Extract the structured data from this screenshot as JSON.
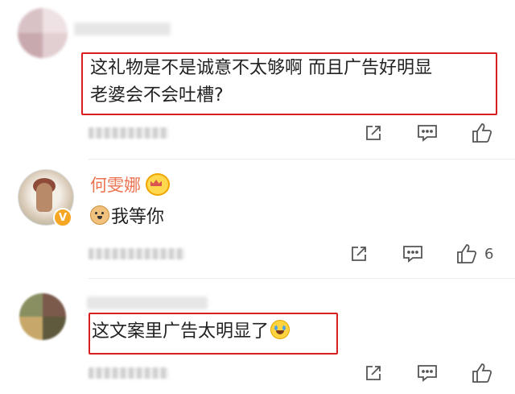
{
  "comments": [
    {
      "text": "这礼物是不是诚意不太够啊  而且广告好明显  老婆会不会吐槽?",
      "line1": "这礼物是不是诚意不太够啊  而且广告好明显",
      "line2": "老婆会不会吐槽?",
      "likes": ""
    },
    {
      "username": "何雯娜",
      "text": "我等你",
      "likes": "6"
    },
    {
      "text": "这文案里广告太明显了",
      "likes": ""
    }
  ],
  "icons": {
    "share": "share-icon",
    "comment": "comment-icon",
    "like": "thumbs-up-icon",
    "crown": "crown-icon",
    "verified": "verified-badge-icon"
  },
  "colors": {
    "username": "#eb7350",
    "highlight": "#d81e1e",
    "verified": "#f5a623"
  }
}
